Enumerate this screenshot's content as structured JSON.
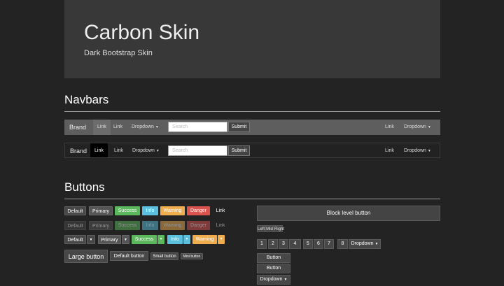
{
  "header": {
    "title": "Carbon Skin",
    "subtitle": "Dark Bootstrap Skin"
  },
  "sections": {
    "navbars": "Navbars",
    "buttons": "Buttons"
  },
  "navbar_default": {
    "brand": "Brand",
    "link_active": "Link",
    "link": "Link",
    "dropdown": "Dropdown",
    "search_placeholder": "Search",
    "submit": "Submit",
    "right_link": "Link",
    "right_dropdown": "Dropdown"
  },
  "navbar_inverse": {
    "brand": "Brand",
    "link_active": "Link",
    "link": "Link",
    "dropdown": "Dropdown",
    "search_placeholder": "Search",
    "submit": "Submit",
    "right_link": "Link",
    "right_dropdown": "Dropdown"
  },
  "buttons": {
    "default": "Default",
    "primary": "Primary",
    "success": "Success",
    "info": "Info",
    "warning": "Warning",
    "danger": "Danger",
    "link": "Link"
  },
  "sizes": {
    "large": "Large button",
    "default": "Default button",
    "small": "Small button",
    "mini": "Mini button"
  },
  "block": "Block level button",
  "group": {
    "left": "Left",
    "middle": "Mid",
    "right": "Right"
  },
  "pagination": [
    "1",
    "2",
    "3",
    "4",
    "5",
    "6",
    "7",
    "8"
  ],
  "toolbar_dropdown": "Dropdown",
  "vertical": {
    "b1": "Button",
    "b2": "Button",
    "dropdown": "Dropdown"
  },
  "colors": {
    "success": "#5cb85c",
    "info": "#5bc0de",
    "warning": "#f0ad4e",
    "danger": "#d9534f"
  }
}
